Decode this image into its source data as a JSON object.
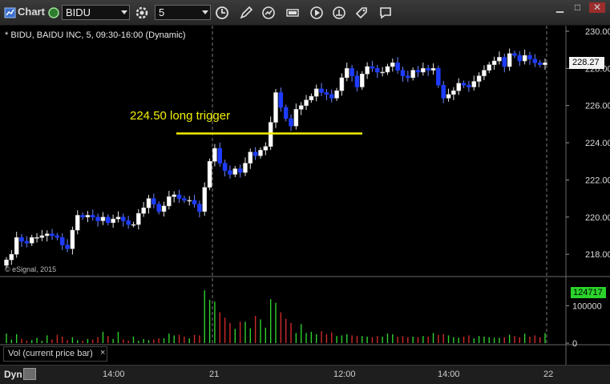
{
  "toolbar": {
    "app_title": "Chart",
    "symbol": "BIDU",
    "interval": "5"
  },
  "chart": {
    "header": "* BIDU, BAIDU INC, 5, 09:30-16:00 (Dynamic)",
    "copyright": "© eSignal, 2015",
    "annotation": "224.50 long trigger",
    "last_price": "228.27",
    "volume_tag": "124717",
    "volume_panel_label": "Vol (current price bar)",
    "dyn_label": "Dyn",
    "close_glyph": "×"
  },
  "colors": {
    "up": "#ffffff",
    "down": "#1d3cff",
    "vol_up": "#2fd12f",
    "vol_down": "#d12a2a",
    "trigger": "#f3f000"
  },
  "chart_data": {
    "type": "candlestick",
    "y_ticks": [
      "230.00",
      "228.00",
      "226.00",
      "224.00",
      "222.00",
      "220.00",
      "218.00"
    ],
    "y_range": [
      216.8,
      230.3
    ],
    "volume_ticks": [
      "100000",
      "0"
    ],
    "time_labels": [
      "14:00",
      "21",
      "12:00",
      "14:00",
      "22"
    ],
    "trigger_level": 224.5,
    "closes": [
      217.7,
      218.0,
      218.9,
      218.7,
      218.6,
      218.9,
      218.9,
      219.0,
      219.1,
      219.0,
      218.9,
      218.5,
      218.3,
      219.3,
      220.1,
      220.0,
      220.1,
      220.0,
      219.8,
      220.0,
      219.7,
      219.9,
      220.0,
      219.8,
      219.6,
      219.6,
      220.2,
      220.5,
      221.0,
      220.7,
      220.3,
      220.6,
      221.1,
      221.2,
      221.0,
      220.9,
      220.9,
      220.7,
      220.3,
      221.6,
      223.0,
      223.7,
      222.9,
      222.5,
      222.3,
      222.6,
      222.4,
      222.9,
      223.5,
      223.3,
      223.6,
      223.8,
      225.1,
      226.7,
      225.9,
      225.3,
      224.9,
      225.8,
      226.0,
      226.3,
      226.5,
      226.9,
      226.7,
      226.6,
      226.4,
      226.8,
      227.5,
      228.0,
      227.6,
      227.0,
      227.7,
      228.1,
      228.0,
      227.8,
      227.8,
      228.1,
      228.3,
      227.9,
      227.6,
      227.5,
      227.9,
      227.8,
      228.0,
      227.9,
      228.0,
      227.1,
      226.4,
      226.6,
      226.8,
      227.2,
      227.1,
      227.0,
      227.3,
      227.6,
      227.9,
      228.2,
      228.4,
      228.6,
      228.1,
      228.8,
      228.7,
      228.4,
      228.7,
      228.5,
      228.3,
      228.2,
      228.3
    ],
    "volumes": [
      16,
      6,
      15,
      7,
      4,
      5,
      9,
      4,
      13,
      6,
      14,
      11,
      5,
      10,
      5,
      4,
      7,
      6,
      10,
      19,
      12,
      7,
      19,
      6,
      4,
      11,
      4,
      7,
      5,
      6,
      8,
      8,
      16,
      13,
      14,
      11,
      8,
      14,
      13,
      89,
      73,
      70,
      52,
      43,
      34,
      24,
      36,
      36,
      25,
      46,
      40,
      26,
      74,
      68,
      52,
      41,
      34,
      17,
      32,
      17,
      19,
      15,
      20,
      15,
      18,
      12,
      13,
      15,
      13,
      12,
      12,
      11,
      10,
      12,
      11,
      16,
      15,
      11,
      12,
      10,
      11,
      10,
      12,
      11,
      17,
      14,
      15,
      13,
      10,
      9,
      11,
      13,
      8,
      12,
      11,
      10,
      9,
      9,
      10,
      14,
      12,
      10,
      16,
      11,
      13,
      10,
      17,
      77
    ]
  }
}
